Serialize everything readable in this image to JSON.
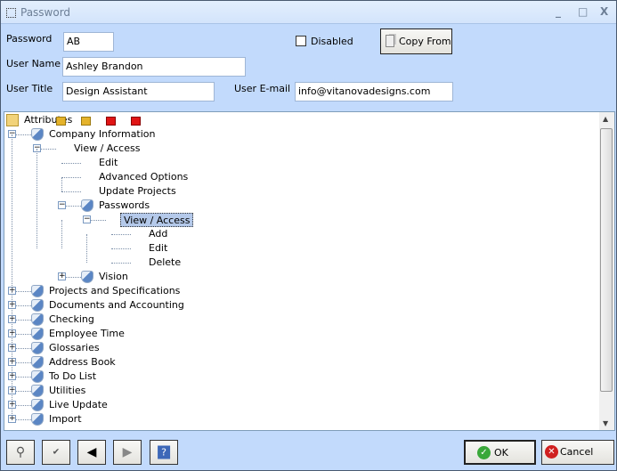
{
  "window": {
    "title": "Password",
    "minimize": "_",
    "maximize": "□",
    "close": "X"
  },
  "form": {
    "password_label": "Password",
    "password_value": "AB",
    "disabled_label": "Disabled",
    "disabled_checked": false,
    "copy_from_label": "Copy From",
    "user_name_label": "User Name",
    "user_name_value": "Ashley Brandon",
    "user_title_label": "User Title",
    "user_title_value": "Design Assistant",
    "user_email_label": "User E-mail",
    "user_email_value": "info@vitanovadesigns.com"
  },
  "tree": {
    "items": [
      {
        "label": "Attributes",
        "level": -1,
        "icon": "folder",
        "expander": ""
      },
      {
        "label": "Company Information",
        "level": 0,
        "icon": "shield",
        "expander": "-"
      },
      {
        "label": "View / Access",
        "level": 1,
        "icon": "lock-open-yellow",
        "expander": "-"
      },
      {
        "label": "Edit",
        "level": 2,
        "icon": "lock-open-yellow",
        "expander": ""
      },
      {
        "label": "Advanced Options",
        "level": 2,
        "icon": "lock-open-yellow",
        "expander": ""
      },
      {
        "label": "Update Projects",
        "level": 2,
        "icon": "lock-open-yellow",
        "expander": ""
      },
      {
        "label": "Passwords",
        "level": 2,
        "icon": "shield",
        "expander": "-"
      },
      {
        "label": "View / Access",
        "level": 3,
        "icon": "lock-red",
        "expander": "-",
        "selected": true
      },
      {
        "label": "Add",
        "level": 4,
        "icon": "lock-red",
        "expander": ""
      },
      {
        "label": "Edit",
        "level": 4,
        "icon": "lock-red",
        "expander": ""
      },
      {
        "label": "Delete",
        "level": 4,
        "icon": "lock-red",
        "expander": ""
      },
      {
        "label": "Vision",
        "level": 2,
        "icon": "shield",
        "expander": "+"
      },
      {
        "label": "Projects and Specifications",
        "level": 0,
        "icon": "shield",
        "expander": "+"
      },
      {
        "label": "Documents and Accounting",
        "level": 0,
        "icon": "shield",
        "expander": "+"
      },
      {
        "label": "Checking",
        "level": 0,
        "icon": "shield",
        "expander": "+"
      },
      {
        "label": "Employee Time",
        "level": 0,
        "icon": "shield",
        "expander": "+"
      },
      {
        "label": "Glossaries",
        "level": 0,
        "icon": "shield",
        "expander": "+"
      },
      {
        "label": "Address Book",
        "level": 0,
        "icon": "shield",
        "expander": "+"
      },
      {
        "label": "To Do List",
        "level": 0,
        "icon": "shield",
        "expander": "+"
      },
      {
        "label": "Utilities",
        "level": 0,
        "icon": "shield",
        "expander": "+"
      },
      {
        "label": "Live Update",
        "level": 0,
        "icon": "shield",
        "expander": "+"
      },
      {
        "label": "Import",
        "level": 0,
        "icon": "shield",
        "expander": "+"
      }
    ]
  },
  "footer": {
    "ok_label": "OK",
    "cancel_label": "Cancel"
  }
}
